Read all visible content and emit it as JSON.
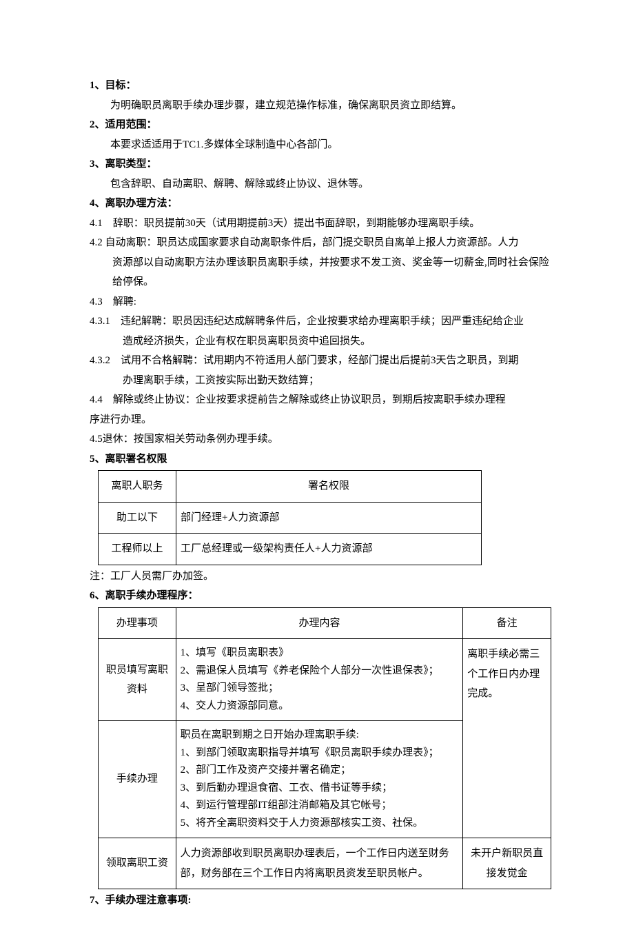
{
  "s1": {
    "head": "1、目标：",
    "body": "为明确职员离职手续办理步骤，建立规范操作标准，确保离职员资立即结算。"
  },
  "s2": {
    "head": "2、适用范围：",
    "body": "本要求适适用于TC1.多媒体全球制造中心各部门。"
  },
  "s3": {
    "head": "3、离职类型：",
    "body": "包含辞职、自动离职、解聘、解除或终止协议、退休等。"
  },
  "s4": {
    "head": "4、离职办理方法：",
    "p41": "4.1　辞职：职员提前30天（试用期提前3天）提出书面辞职，到期能够办理离职手续。",
    "p42a": "4.2  自动离职：职员达成国家要求自动离职条件后，部门提交职员自离单上报人力资源部。人力",
    "p42b": "资源部以自动离职方法办理该职员离职手续，并按要求不发工资、奖金等一切薪金,同时社会保险给停保。",
    "p43": "4.3　解聘:",
    "p431a": "4.3.1　违纪解聘：职员因违纪达成解聘条件后，企业按要求给办理离职手续；因严重违纪给企业",
    "p431b": "造成经济损失，企业有权在职员离职员资中追回损失。",
    "p432a": "4.3.2　试用不合格解聘：试用期内不符适用人部门要求，经部门提出后提前3天告之职员，到期",
    "p432b": "办理离职手续，工资按实际出勤天数结算；",
    "p44a": "4.4　解除或终止协议：企业按要求提前告之解除或终止协议职员，到期后按离职手续办理程",
    "p44b": "序进行办理。",
    "p45": "4.5退休：按国家相关劳动条例办理手续。"
  },
  "s5": {
    "head": "5、离职署名权限",
    "th1": "离职人职务",
    "th2": "署名权限",
    "r1c1": "助工以下",
    "r1c2": "部门经理+人力资源部",
    "r2c1": "工程师以上",
    "r2c2": "工厂总经理或一级架构责任人+人力资源部",
    "note": "注：工厂人员需厂办加签。"
  },
  "s6": {
    "head": "6、离职手续办理程序：",
    "th1": "办理事项",
    "th2": "办理内容",
    "th3": "备注",
    "r1c1": "职员填写离职资料",
    "r1c2": "1、填写《职员离职表》\n2、需退保人员填写《养老保险个人部分一次性退保表》；\n3、呈部门领导签批；\n4、交人力资源部同意。",
    "r12c3": "离职手续必需三个工作日内办理完成。",
    "r2c1": "手续办理",
    "r2c2": "职员在离职到期之日开始办理离职手续:\n1、到部门领取离职指导并填写《职员离职手续办理表》；\n2、部门工作及资产交接并署名确定；\n3、到后勤办理退食宿、工衣、借书证等手续；\n4、到运行管理部IT组部注消邮箱及其它帐号；\n5、将齐全离职资料交于人力资源部核实工资、社保。",
    "r3c1": "领取离职工资",
    "r3c2": "人力资源部收到职员离职办理表后，一个工作日内送至财务部，财务部在三个工作日内将离职员资发至职员帐户。",
    "r3c3": "未开户新职员直接发觉金"
  },
  "s7": {
    "head": "7、手续办理注意事项:"
  }
}
